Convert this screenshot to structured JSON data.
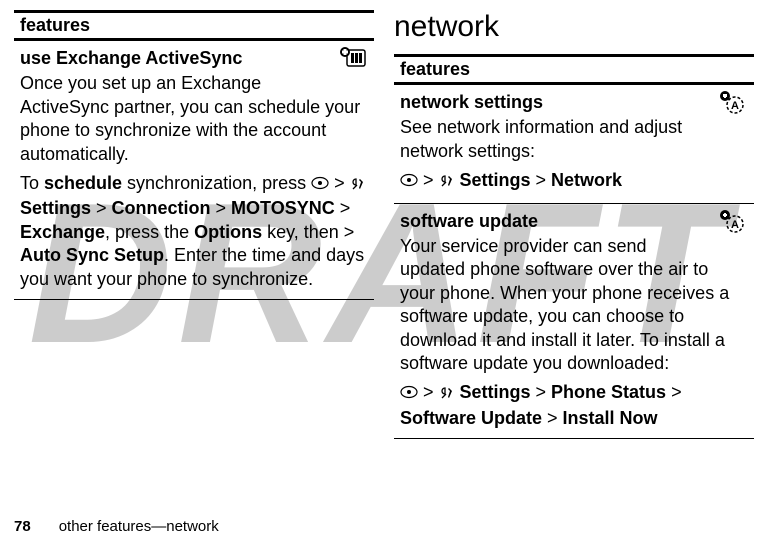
{
  "watermark": "DRAFT",
  "left": {
    "table_header": "features",
    "row1": {
      "heading": "use Exchange ActiveSync",
      "p1": "Once you set up an Exchange ActiveSync partner, you can schedule your phone to synchronize with the account automatically.",
      "p2_a": "To ",
      "p2_bold": "schedule",
      "p2_b": " synchronization, press ",
      "gt1": " > ",
      "settings": " Settings",
      "gt2": " > ",
      "connection": "Connection",
      "gt3": " > ",
      "motosync": "MOTOSYNC",
      "gt4": " > ",
      "exchange": "Exchange",
      "p2_c": ", press the ",
      "options": "Options",
      "p2_d": " key, then > ",
      "autosync": "Auto Sync Setup",
      "p2_e": ". Enter the time and days you want your phone to synchronize."
    }
  },
  "right": {
    "section_title": "network",
    "table_header": "features",
    "row1": {
      "heading": "network settings",
      "p1": "See network information and adjust network settings:",
      "gt1": " > ",
      "settings": " Settings",
      "gt2": " > ",
      "network": "Network"
    },
    "row2": {
      "heading": "software update",
      "p1": "Your service provider can send updated phone software over the air to your phone. When your phone receives a software update, you can choose to download it and install it later. To install a software update you downloaded:",
      "gt1": " > ",
      "settings": " Settings",
      "gt2": " > ",
      "phone_status": "Phone Status",
      "gt3": " > ",
      "software_update": "Software Update",
      "gt4": " > ",
      "install_now": "Install Now"
    }
  },
  "footer": {
    "page": "78",
    "text": "other features—network"
  }
}
